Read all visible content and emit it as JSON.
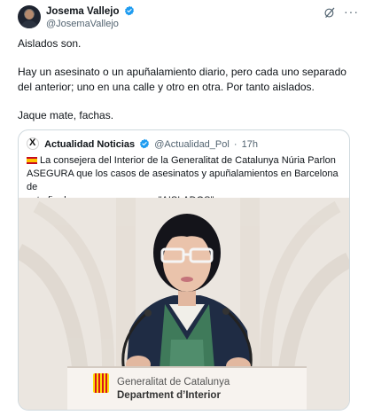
{
  "author": {
    "name": "Josema Vallejo",
    "handle": "@JosemaVallejo"
  },
  "body": {
    "line1": "Aislados son.",
    "line2": "Hay un asesinato o un apuñalamiento diario, pero cada uno separado",
    "line3": "del anterior; uno en una calle y otro en otra. Por tanto aislados.",
    "line4": "Jaque mate, fachas."
  },
  "quoted": {
    "logo_letter": "X",
    "name": "Actualidad Noticias",
    "handle": "@Actualidad_Pol",
    "separator": "·",
    "time": "17h",
    "text_line1": "La consejera del Interior de la Generalitat de Catalunya Núria Parlon",
    "text_line2": "ASEGURA que los casos de asesinatos y apuñalamientos en Barcelona de",
    "text_line3": "este fin de semana son casos \"AISLADOS\"",
    "photo": {
      "lectern_line1": "Generalitat de Catalunya",
      "lectern_line2": "Department d’Interior"
    }
  },
  "icons": {
    "verified": "verified-badge-icon",
    "grok": "grok-icon",
    "more": "more-icon",
    "flag": "spain-flag-icon"
  },
  "colors": {
    "verified": "#1d9bf0",
    "secondary_text": "#536471",
    "border": "#cfd9de"
  }
}
